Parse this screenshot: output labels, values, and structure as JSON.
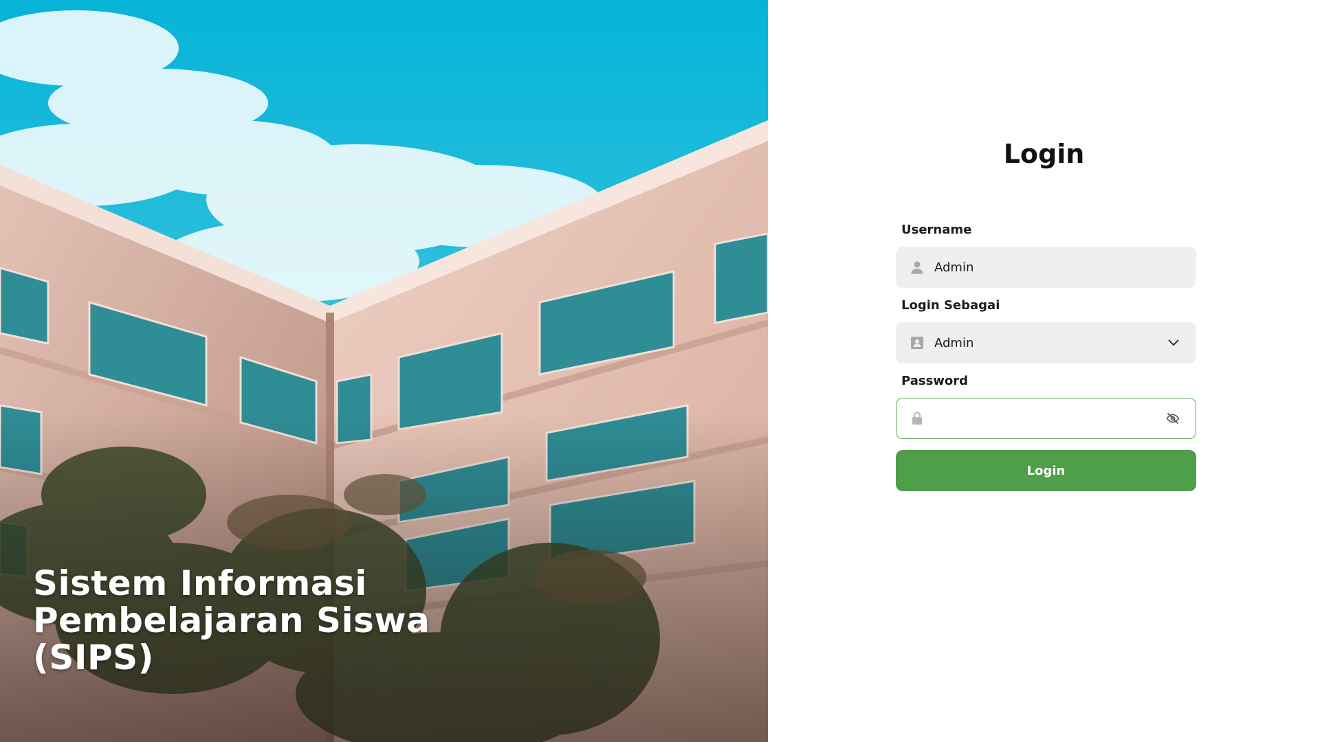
{
  "hero": {
    "title_lines": [
      "Sistem Informasi",
      "Pembelajaran Siswa",
      "(SIPS)"
    ]
  },
  "login": {
    "title": "Login",
    "username": {
      "label": "Username",
      "value": "Admin",
      "icon": "user-icon"
    },
    "role": {
      "label": "Login Sebagai",
      "value": "Admin",
      "icon": "id-badge-icon",
      "dropdown_icon": "chevron-down-icon"
    },
    "password": {
      "label": "Password",
      "value": "",
      "icon": "lock-icon",
      "toggle_icon": "eye-slash-icon"
    },
    "submit_label": "Login"
  },
  "colors": {
    "accent": "#4f9e49",
    "focus_border": "#58a952",
    "input_bg": "#efefef",
    "hero_sky": "#0fb6d6"
  }
}
